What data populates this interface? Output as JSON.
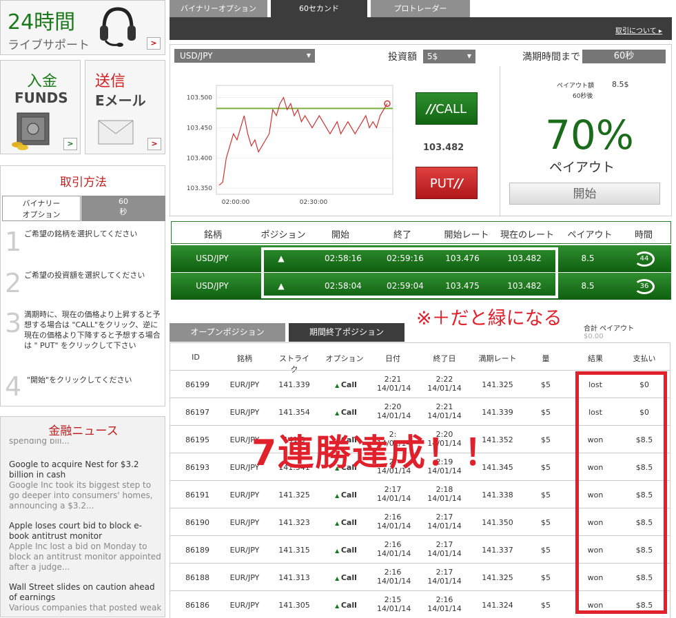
{
  "support": {
    "title": "24時間",
    "subtitle": "ライブサポート",
    "arrow": ">"
  },
  "funds": {
    "jp": "入金",
    "en": "FUNDS"
  },
  "email": {
    "jp": "送信",
    "en": "Eメール"
  },
  "howto": {
    "title": "取引方法",
    "tab1": "バイナリー\nオプション",
    "tab2": "60\n秒",
    "steps": [
      {
        "num": "1",
        "text": "ご希望の銘柄を選択してください"
      },
      {
        "num": "2",
        "text": "ご希望の投資額を選択してください"
      },
      {
        "num": "3",
        "text": "満期時に、現在の価格より上昇すると予想する場合は \"CALL\"をクリック、逆に現在の価格より下降すると予想する場合は \" PUT\" をクリックして下さい"
      },
      {
        "num": "4",
        "text": "\"開始\"をクリックしてください"
      }
    ]
  },
  "news": {
    "title": "金融ニュース",
    "items": [
      {
        "headline": "",
        "summary": "spending bill..."
      },
      {
        "headline": "Google to acquire Nest for $3.2 billion in cash",
        "summary": "Google Inc took its biggest step to go deeper into consumers' homes, announcing a $3.2..."
      },
      {
        "headline": "Apple loses court bid to block e-book antitrust monitor",
        "summary": "Apple Inc lost a bid on Monday to block an antitrust monitor appointed after a judge..."
      },
      {
        "headline": "Wall Street slides on caution ahead of earnings",
        "summary": "Various companies that posted weak"
      }
    ]
  },
  "tabs": [
    "バイナリーオプション",
    "60セカンド",
    "プロトレーダー"
  ],
  "about_link": "取引について",
  "trade": {
    "asset": "USD/JPY",
    "amount_label": "投資額",
    "amount": "5$",
    "expiry_label": "満期時間まで",
    "expiry": "60秒",
    "price": "103.482",
    "call": "CALL",
    "put": "PUT"
  },
  "chart_data": {
    "type": "line",
    "x_ticks": [
      "02:00:00",
      "02:30:00"
    ],
    "y_ticks": [
      "103.500",
      "103.450",
      "103.400",
      "103.350"
    ],
    "ylim": [
      103.34,
      103.52
    ],
    "strike": 103.482,
    "values": [
      103.355,
      103.36,
      103.4,
      103.42,
      103.44,
      103.43,
      103.45,
      103.47,
      103.44,
      103.42,
      103.43,
      103.41,
      103.42,
      103.43,
      103.44,
      103.48,
      103.47,
      103.49,
      103.5,
      103.48,
      103.49,
      103.47,
      103.48,
      103.46,
      103.47,
      103.46,
      103.45,
      103.46,
      103.47,
      103.46,
      103.45,
      103.44,
      103.45,
      103.46,
      103.44,
      103.45,
      103.46,
      103.45,
      103.44,
      103.45,
      103.46,
      103.47,
      103.45,
      103.46,
      103.45,
      103.47,
      103.48,
      103.49
    ]
  },
  "payout": {
    "amount_label": "ペイアウト額",
    "amount": "8.5$",
    "after": "60秒後",
    "percent": "70%",
    "label": "ペイアウト",
    "start": "開始"
  },
  "positions": {
    "headers": [
      "銘柄",
      "ポジション",
      "開始",
      "終了",
      "開始レート",
      "現在のレート",
      "ペイアウト",
      "時間"
    ],
    "rows": [
      {
        "asset": "USD/JPY",
        "start": "02:58:16",
        "end": "02:59:16",
        "open_rate": "103.476",
        "current": "103.482",
        "payout": "8.5",
        "time": "44"
      },
      {
        "asset": "USD/JPY",
        "start": "02:58:04",
        "end": "02:59:04",
        "open_rate": "103.475",
        "current": "103.482",
        "payout": "8.5",
        "time": "36"
      }
    ]
  },
  "note": "※＋だと緑になる",
  "history_tabs": [
    "オープンポジション",
    "期間終了ポジション"
  ],
  "total": {
    "label": "合計 ペイアウト",
    "value": "$0.00"
  },
  "history": {
    "headers": [
      "ID",
      "銘柄",
      "ストライク",
      "オプション",
      "日付",
      "終了日",
      "満期レート",
      "量",
      "結果",
      "支払い"
    ],
    "rows": [
      {
        "id": "86199",
        "asset": "EUR/JPY",
        "strike": "141.339",
        "option": "Call",
        "d1": "2:21",
        "d2": "14/01/14",
        "e1": "2:22",
        "e2": "14/01/14",
        "rate": "141.325",
        "amt": "$5",
        "result": "lost",
        "pay": "$0"
      },
      {
        "id": "86197",
        "asset": "EUR/JPY",
        "strike": "141.354",
        "option": "Call",
        "d1": "2:20",
        "d2": "14/01/14",
        "e1": "2:21",
        "e2": "14/01/14",
        "rate": "141.339",
        "amt": "$5",
        "result": "lost",
        "pay": "$0"
      },
      {
        "id": "86195",
        "asset": "EUR/JPY",
        "strike": "141.3",
        "option": "Call",
        "d1": "2:",
        "d2": "14/01/14",
        "e1": "2:20",
        "e2": "14/01/14",
        "rate": "141.352",
        "amt": "$5",
        "result": "won",
        "pay": "$8.5"
      },
      {
        "id": "86193",
        "asset": "EUR/JPY",
        "strike": "141.341",
        "option": "Call",
        "d1": "2:",
        "d2": "14/01/14",
        "e1": "2:19",
        "e2": "14/01/14",
        "rate": "141.345",
        "amt": "$5",
        "result": "won",
        "pay": "$8.5"
      },
      {
        "id": "86191",
        "asset": "EUR/JPY",
        "strike": "141.325",
        "option": "Call",
        "d1": "2:17",
        "d2": "14/01/14",
        "e1": "2:18",
        "e2": "14/01/14",
        "rate": "141.338",
        "amt": "$5",
        "result": "won",
        "pay": "$8.5"
      },
      {
        "id": "86190",
        "asset": "EUR/JPY",
        "strike": "141.323",
        "option": "Call",
        "d1": "2:16",
        "d2": "14/01/14",
        "e1": "2:17",
        "e2": "14/01/14",
        "rate": "141.350",
        "amt": "$5",
        "result": "won",
        "pay": "$8.5"
      },
      {
        "id": "86189",
        "asset": "EUR/JPY",
        "strike": "141.315",
        "option": "Call",
        "d1": "2:16",
        "d2": "14/01/14",
        "e1": "2:17",
        "e2": "14/01/14",
        "rate": "141.337",
        "amt": "$5",
        "result": "won",
        "pay": "$8.5"
      },
      {
        "id": "86188",
        "asset": "EUR/JPY",
        "strike": "141.313",
        "option": "Call",
        "d1": "2:16",
        "d2": "14/01/14",
        "e1": "2:17",
        "e2": "14/01/14",
        "rate": "141.325",
        "amt": "$5",
        "result": "won",
        "pay": "$8.5"
      },
      {
        "id": "86186",
        "asset": "EUR/JPY",
        "strike": "141.305",
        "option": "Call",
        "d1": "2:15",
        "d2": "14/01/14",
        "e1": "2:16",
        "e2": "14/01/14",
        "rate": "141.324",
        "amt": "$5",
        "result": "won",
        "pay": "$8.5"
      }
    ]
  },
  "overlay": "7連勝達成！！",
  "colors": {
    "green": "#1a7a1a",
    "red": "#e0202a",
    "dark": "#3c3c3c"
  }
}
